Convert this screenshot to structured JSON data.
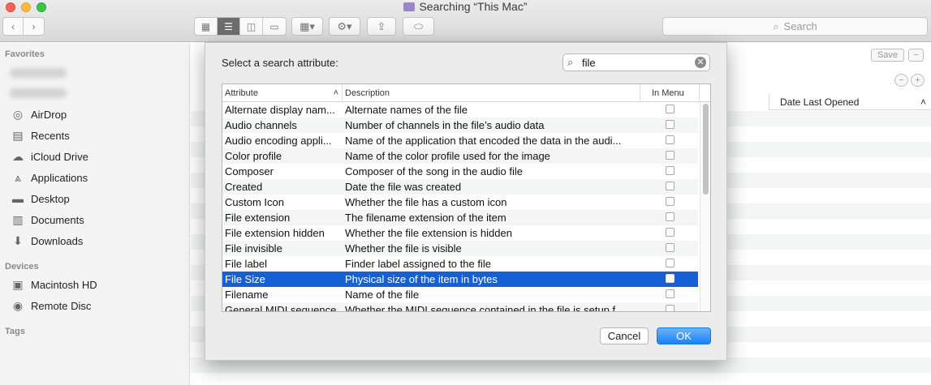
{
  "window": {
    "title": "Searching “This Mac”",
    "search_placeholder": "Search"
  },
  "sidebar": {
    "favorites_header": "Favorites",
    "favorites": [
      {
        "label": "AirDrop",
        "icon": "airdrop-icon"
      },
      {
        "label": "Recents",
        "icon": "clock-icon"
      },
      {
        "label": "iCloud Drive",
        "icon": "cloud-icon"
      },
      {
        "label": "Applications",
        "icon": "applications-icon"
      },
      {
        "label": "Desktop",
        "icon": "desktop-icon"
      },
      {
        "label": "Documents",
        "icon": "document-icon"
      },
      {
        "label": "Downloads",
        "icon": "download-icon"
      }
    ],
    "devices_header": "Devices",
    "devices": [
      {
        "label": "Macintosh HD",
        "icon": "hard-drive-icon"
      },
      {
        "label": "Remote Disc",
        "icon": "disc-icon"
      }
    ],
    "tags_header": "Tags"
  },
  "content": {
    "save_label": "Save",
    "date_last_opened_header": "Date Last Opened"
  },
  "dialog": {
    "title": "Select a search attribute:",
    "search_value": "file",
    "columns": {
      "attribute": "Attribute",
      "description": "Description",
      "in_menu": "In Menu"
    },
    "rows": [
      {
        "attribute": "Alternate display nam...",
        "description": "Alternate names of the file"
      },
      {
        "attribute": "Audio channels",
        "description": "Number of channels in the file’s audio data"
      },
      {
        "attribute": "Audio encoding appli...",
        "description": "Name of the application that encoded the data in the audi..."
      },
      {
        "attribute": "Color profile",
        "description": "Name of the color profile used for the image"
      },
      {
        "attribute": "Composer",
        "description": "Composer of the song in the audio file"
      },
      {
        "attribute": "Created",
        "description": "Date the file was created"
      },
      {
        "attribute": "Custom Icon",
        "description": "Whether the file has a custom icon"
      },
      {
        "attribute": "File extension",
        "description": "The filename extension of the item"
      },
      {
        "attribute": "File extension hidden",
        "description": "Whether the file extension is hidden"
      },
      {
        "attribute": "File invisible",
        "description": "Whether the file is visible"
      },
      {
        "attribute": "File label",
        "description": "Finder label assigned to the file"
      },
      {
        "attribute": "File Size",
        "description": "Physical size of the item in bytes"
      },
      {
        "attribute": "Filename",
        "description": "Name of the file"
      },
      {
        "attribute": "General MIDI sequence",
        "description": "Whether the MIDI sequence contained in the file is setup f..."
      }
    ],
    "selected_index": 11,
    "cancel_label": "Cancel",
    "ok_label": "OK"
  },
  "colors": {
    "selection": "#1460d4",
    "ok_button": "#1a82fb"
  }
}
